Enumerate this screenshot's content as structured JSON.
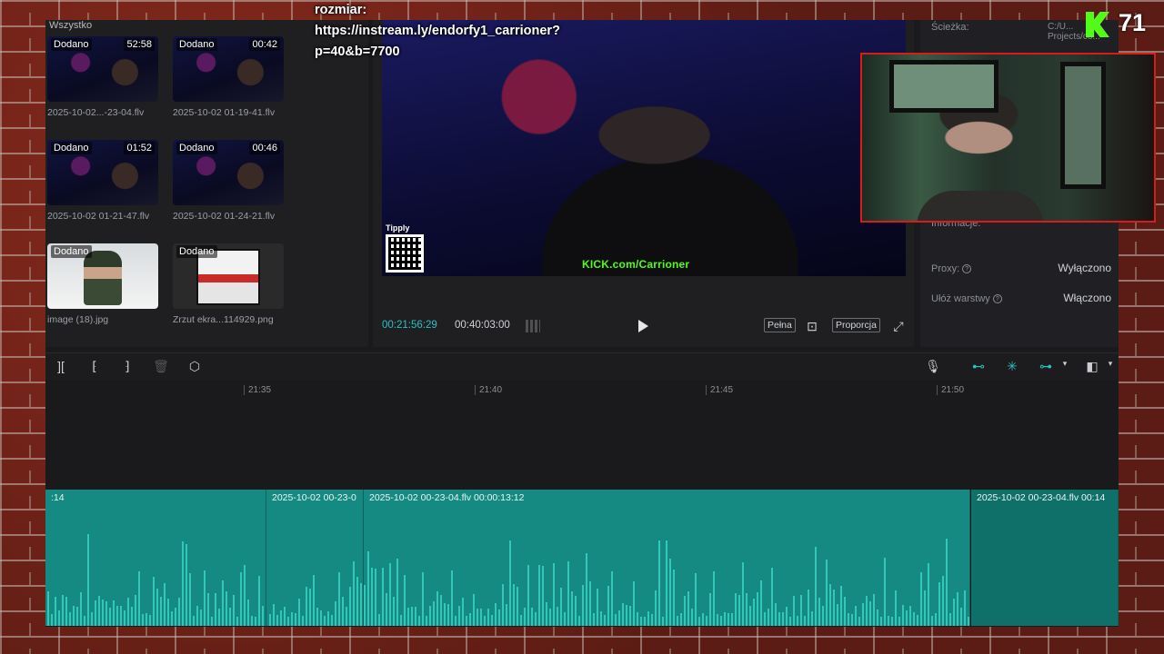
{
  "media": {
    "filter_label": "Wszystko",
    "items": [
      {
        "badge": "Dodano",
        "duration": "52:58",
        "name": "2025-10-02...-23-04.flv"
      },
      {
        "badge": "Dodano",
        "duration": "00:42",
        "name": "2025-10-02 01-19-41.flv"
      },
      {
        "badge": "Dodano",
        "duration": "01:52",
        "name": "2025-10-02 01-21-47.flv"
      },
      {
        "badge": "Dodano",
        "duration": "00:46",
        "name": "2025-10-02 01-24-21.flv"
      },
      {
        "badge": "Dodano",
        "duration": "",
        "name": "image (18).jpg"
      },
      {
        "badge": "Dodano",
        "duration": "",
        "name": "Zrzut ekra...114929.png"
      }
    ]
  },
  "player": {
    "video_tipply": "Tipply",
    "video_kick": "KICK.com/Carrioner",
    "current_time": "00:21:56:29",
    "total_time": "00:40:03:00",
    "full_label": "Pełna",
    "ratio_label": "Proporcja"
  },
  "props": {
    "path_label": "Ścieżka:",
    "path_value": "C:/U... Projects/co...",
    "info_label": "Informacje:",
    "proxy_label": "Proxy:",
    "proxy_value": "Wyłączono",
    "layers_label": "Ułóż warstwy",
    "layers_value": "Włączono"
  },
  "ruler": {
    "ticks": [
      "21:35",
      "21:40",
      "21:45",
      "21:50"
    ]
  },
  "track": {
    "clips": [
      {
        "label": ":14"
      },
      {
        "label": "2025-10-02 00-23-0"
      },
      {
        "label": "2025-10-02 00-23-04.flv   00:00:13:12"
      },
      {
        "label": "2025-10-02 00-23-04.flv   00:14"
      }
    ]
  },
  "overlay": {
    "line1": "rozmiar:",
    "line2": "https://instream.ly/endorfy1_carrioner?",
    "line3": "p=40&b=7700",
    "viewer_count": "71"
  },
  "colors": {
    "accent": "#27c2c2",
    "clip": "#148a82",
    "kick_green": "#53fc18",
    "webcam_border": "#d81c1c"
  },
  "icons": {
    "toolbar_left": [
      "split-icon",
      "trim-left-icon",
      "trim-right-icon",
      "delete-icon",
      "marker-icon"
    ],
    "toolbar_right": [
      "microphone-icon",
      "link-icon",
      "magnet-icon",
      "snap-icon",
      "compare-icon"
    ]
  }
}
